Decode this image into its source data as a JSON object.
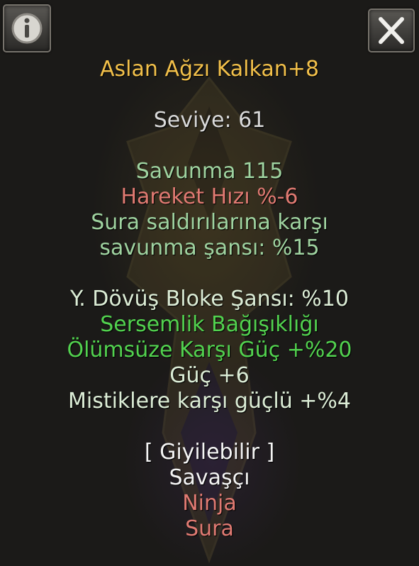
{
  "item": {
    "name": "Aslan Ağzı Kalkan+8",
    "level": "Seviye: 61"
  },
  "stats": {
    "defense": "Savunma 115",
    "move_speed": "Hareket Hızı %-6",
    "sura_defense_line1": "Sura saldırılarına karşı",
    "sura_defense_line2": "savunma şansı: %15"
  },
  "bonuses": {
    "melee_block": "Y. Dövüş Bloke Şansı: %10",
    "stun_immunity": "Sersemlik Bağışıklığı",
    "vs_undead": "Ölümsüze Karşı Güç +%20",
    "strength": "Güç +6",
    "vs_mystics": "Mistiklere karşı güçlü +%4"
  },
  "wearable": {
    "header": "[ Giyilebilir ]",
    "warrior": "Savaşçı",
    "ninja": "Ninja",
    "sura": "Sura"
  },
  "icons": {
    "info": "info-icon",
    "close": "close-icon"
  },
  "colors": {
    "name": "#f2c04a",
    "level": "#d9d9d9",
    "base_stat": "#9fd3a0",
    "penalty": "#e07a72",
    "bonus_green": "#52d24f",
    "bonus_light": "#dcedd6",
    "white": "#f4f4f4"
  }
}
